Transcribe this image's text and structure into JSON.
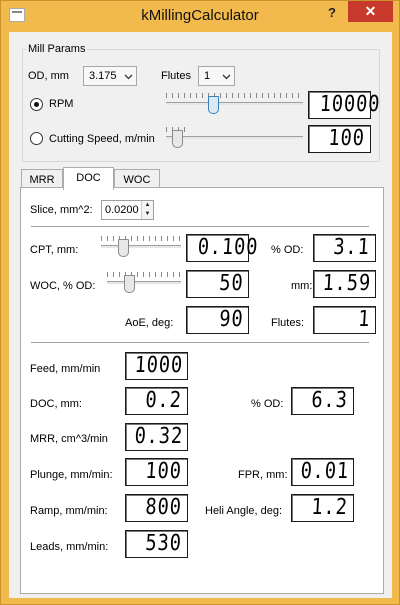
{
  "window": {
    "title": "kMillingCalculator",
    "help_glyph": "?",
    "close_glyph": "✕",
    "accent": "#f2ba4c",
    "close_color": "#c7392b"
  },
  "mill_params": {
    "group_label": "Mill Params",
    "od_label": "OD, mm",
    "od_value": "3.175",
    "flutes_label": "Flutes",
    "flutes_value": "1",
    "rpm_label": "RPM",
    "rpm_selected": true,
    "rpm_display": "10000",
    "rpm_slider_fraction": 0.33,
    "cs_label": "Cutting Speed, m/min",
    "cs_display": "100",
    "cs_slider_fraction": 0.05
  },
  "tabs": [
    {
      "label": "MRR",
      "active": false
    },
    {
      "label": "DOC",
      "active": true
    },
    {
      "label": "WOC",
      "active": false
    }
  ],
  "doc_tab": {
    "slice_label": "Slice, mm^2:",
    "slice_value": "0.0200",
    "cpt_label": "CPT, mm:",
    "cpt_value": "0.100",
    "cpt_slider_fraction": 0.25,
    "cpt_pct_label": "% OD:",
    "cpt_pct_value": "3.1",
    "woc_label": "WOC, % OD:",
    "woc_value": "50",
    "woc_slider_fraction": 0.27,
    "woc_mm_label": "mm:",
    "woc_mm_value": "1.59",
    "aoe_label": "AoE, deg:",
    "aoe_value": "90",
    "flutes_label": "Flutes:",
    "flutes_value": "1",
    "feed_label": "Feed, mm/min",
    "feed_value": "1000",
    "doc_label": "DOC, mm:",
    "doc_value": "0.2",
    "doc_pct_label": "% OD:",
    "doc_pct_value": "6.3",
    "mrr_label": "MRR, cm^3/min",
    "mrr_value": "0.32",
    "plunge_label": "Plunge, mm/min:",
    "plunge_value": "100",
    "fpr_label": "FPR, mm:",
    "fpr_value": "0.01",
    "ramp_label": "Ramp, mm/min:",
    "ramp_value": "800",
    "heli_label": "Heli Angle, deg:",
    "heli_value": "1.2",
    "leads_label": "Leads, mm/min:",
    "leads_value": "530"
  },
  "icons": {
    "help": "help-icon",
    "close": "close-icon",
    "dropdown": "chevron-down-icon",
    "spin": "spin-arrows-icon"
  }
}
